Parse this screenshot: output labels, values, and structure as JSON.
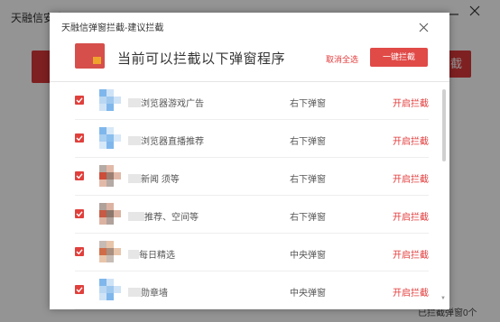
{
  "background": {
    "title": "天融信安全",
    "right_button_label": "截",
    "footer_text": "已拦截弹窗0个"
  },
  "dialog": {
    "title": "天融信弹窗拦截-建议拦截",
    "header_text": "当前可以拦截以下弹窗程序",
    "cancel_all_label": "取消全选",
    "block_all_label": "一键拦截",
    "rows": [
      {
        "name": "浏览器游戏广告",
        "type": "右下弹窗",
        "action": "开启拦截",
        "icon_colors": [
          "#7fb7ec",
          "#b9d7f3",
          "#cfe3f7",
          "#9fc8ef"
        ]
      },
      {
        "name": "浏览器直播推荐",
        "type": "右下弹窗",
        "action": "开启拦截",
        "icon_colors": [
          "#7fb7ec",
          "#a9cff2",
          "#d7e8f8",
          "#8bbfee"
        ]
      },
      {
        "name": "新闻  须等",
        "type": "右下弹窗",
        "action": "开启拦截",
        "icon_colors": [
          "#b5aaa4",
          "#cc4d3a",
          "#e2b9a8",
          "#9b7f72"
        ]
      },
      {
        "name": "推荐、空间等",
        "type": "右下弹窗",
        "action": "开启拦截",
        "icon_colors": [
          "#b0a29b",
          "#c65a44",
          "#dcb3a2",
          "#8c776c"
        ]
      },
      {
        "name": "每日精选",
        "type": "中央弹窗",
        "action": "开启拦截",
        "icon_colors": [
          "#c7bcb5",
          "#d06d48",
          "#e8c5aa",
          "#a88f80"
        ]
      },
      {
        "name": "勋章墙",
        "type": "中央弹窗",
        "action": "开启拦截",
        "icon_colors": [
          "#7fb7ec",
          "#b9d7f3",
          "#cfe3f7",
          "#9fc8ef"
        ]
      }
    ]
  }
}
